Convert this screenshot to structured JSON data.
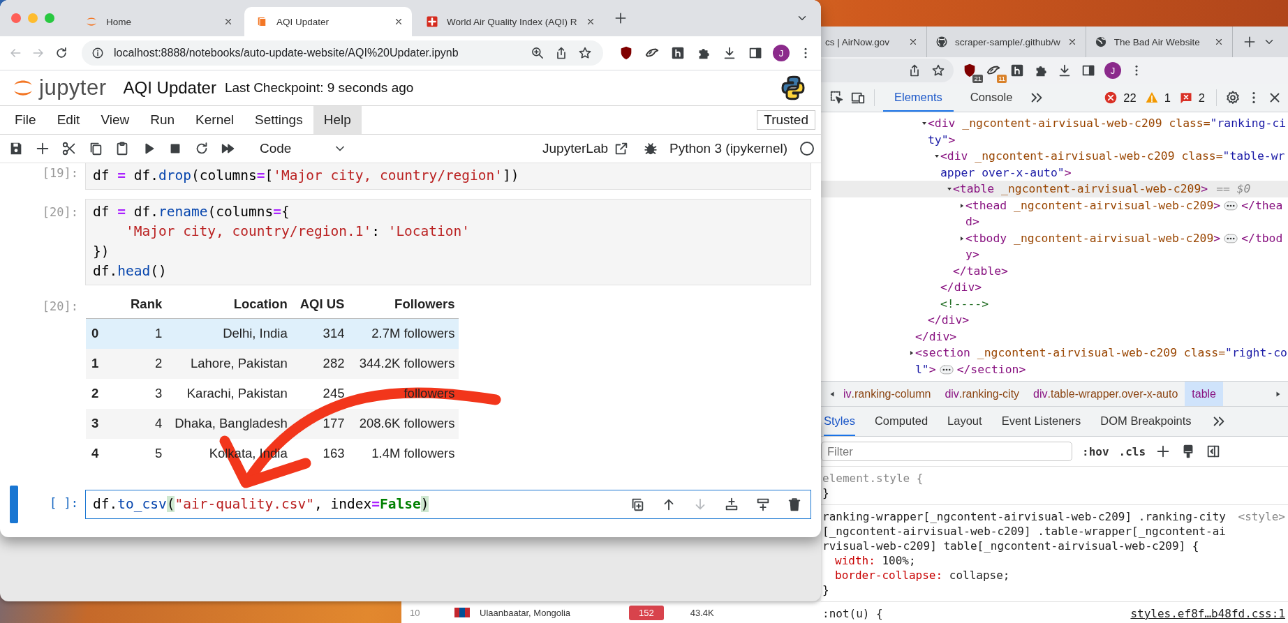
{
  "back_window": {
    "tabs": [
      {
        "title": "cs | AirNow.gov",
        "selected": false
      },
      {
        "title": "scraper-sample/.github/w",
        "selected": false
      },
      {
        "title": "The Bad Air Website",
        "selected": false
      }
    ],
    "extension_badges": [
      "21",
      "11"
    ],
    "avatar": "J",
    "page_row": {
      "rank": "10",
      "location": "Ulaanbaatar, Mongolia",
      "aqi": "152",
      "followers": "43.4K"
    },
    "devtools": {
      "panel_tabs": [
        {
          "label": "Elements",
          "selected": true
        },
        {
          "label": "Console",
          "selected": false
        }
      ],
      "counts": {
        "errors": "22",
        "warnings": "1",
        "issues": "2"
      },
      "dom": [
        {
          "close": "</div>",
          "children": [
            {
              "kind": "element",
              "open": "<div _ngcontent-airvisual-web-c209 class=\"ranking-city\">",
              "selected": false,
              "expanded": true,
              "close": "</div>",
              "children": [
                {
                  "kind": "element",
                  "open": "<div _ngcontent-airvisual-web-c209 class=\"table-wrapper over-x-auto\">",
                  "selected": false,
                  "expanded": true,
                  "close": "</div>",
                  "children": [
                    {
                      "kind": "element",
                      "open": "<table _ngcontent-airvisual-web-c209>",
                      "selected": true,
                      "console_ref": "== $0",
                      "expanded": true,
                      "close": "</table>",
                      "children": [
                        {
                          "kind": "element",
                          "open": "<thead _ngcontent-airvisual-web-c209>",
                          "selected": false,
                          "expanded": false,
                          "close": "</thead>"
                        },
                        {
                          "kind": "element",
                          "open": "<tbody _ngcontent-airvisual-web-c209>",
                          "selected": false,
                          "expanded": false,
                          "close": "</tbody>"
                        }
                      ]
                    }
                  ]
                },
                {
                  "kind": "comment",
                  "open": "<!---->"
                }
              ]
            }
          ]
        },
        {
          "kind": "element",
          "open": "<section _ngcontent-airvisual-web-c209 class=\"right-col\">",
          "selected": false,
          "expanded": false,
          "close": "</section>"
        }
      ],
      "breadcrumbs": [
        {
          "label": "iv.ranking-column",
          "selected": false
        },
        {
          "label": "div.ranking-city",
          "selected": false
        },
        {
          "label": "div.table-wrapper.over-x-auto",
          "selected": false
        },
        {
          "label": "table",
          "selected": true
        }
      ],
      "style_tabs": [
        {
          "label": "Styles",
          "selected": true
        },
        {
          "label": "Computed",
          "selected": false
        },
        {
          "label": "Layout",
          "selected": false
        },
        {
          "label": "Event Listeners",
          "selected": false
        },
        {
          "label": "DOM Breakpoints",
          "selected": false
        }
      ],
      "filter_placeholder": "Filter",
      "hov": ":hov",
      "cls": ".cls",
      "rules": [
        {
          "selector": "element.style {",
          "close": "}"
        },
        {
          "selector": "ranking-wrapper[_ngcontent-airvisual-web-c209] .ranking-city[_ngcontent-airvisual-web-c209] .table-wrapper[_ngcontent-airvisual-web-c209] table[_ngcontent-airvisual-web-c209] {",
          "source": "<style>",
          "props": [
            {
              "name": "width:",
              "value": "100%;"
            },
            {
              "name": "border-collapse:",
              "value": "collapse;"
            }
          ],
          "close": "}"
        },
        {
          "selector": ":not(u) {",
          "source": "styles.ef8f…b48fd.css:1"
        }
      ]
    }
  },
  "front_window": {
    "tabs": [
      {
        "title": "Home",
        "selected": false
      },
      {
        "title": "AQI Updater",
        "selected": true
      },
      {
        "title": "World Air Quality Index (AQI) R",
        "selected": false
      }
    ],
    "url": "localhost:8888/notebooks/auto-update-website/AQI%20Updater.ipynb",
    "avatar": "J",
    "jupyter": {
      "logo_text": "jupyter",
      "title": "AQI Updater",
      "checkpoint": "Last Checkpoint: 9 seconds ago",
      "menu": [
        {
          "label": "File",
          "selected": false
        },
        {
          "label": "Edit",
          "selected": false
        },
        {
          "label": "View",
          "selected": false
        },
        {
          "label": "Run",
          "selected": false
        },
        {
          "label": "Kernel",
          "selected": false
        },
        {
          "label": "Settings",
          "selected": false
        },
        {
          "label": "Help",
          "selected": true
        }
      ],
      "trusted": "Trusted",
      "cell_type": "Code",
      "jupyterlab": "JupyterLab",
      "kernel": "Python 3 (ipykernel)",
      "kernel_busy": false,
      "cells": [
        {
          "kind": "code",
          "prompt": "[19]:",
          "active": false,
          "lines": [
            {
              "tokens": [
                {
                  "text": "df ",
                  "kind": "plain"
                },
                {
                  "text": "=",
                  "kind": "operator"
                },
                {
                  "text": " df.",
                  "kind": "plain"
                },
                {
                  "text": "drop",
                  "kind": "function"
                },
                {
                  "text": "(columns",
                  "kind": "plain"
                },
                {
                  "text": "=",
                  "kind": "operator"
                },
                {
                  "text": "[",
                  "kind": "plain"
                },
                {
                  "text": "'Major city, country/region'",
                  "kind": "string"
                },
                {
                  "text": "])",
                  "kind": "plain"
                }
              ]
            }
          ]
        },
        {
          "kind": "code",
          "prompt": "[20]:",
          "active": false,
          "lines": [
            {
              "tokens": [
                {
                  "text": "df ",
                  "kind": "plain"
                },
                {
                  "text": "=",
                  "kind": "operator"
                },
                {
                  "text": " df.",
                  "kind": "plain"
                },
                {
                  "text": "rename",
                  "kind": "function"
                },
                {
                  "text": "(columns",
                  "kind": "plain"
                },
                {
                  "text": "=",
                  "kind": "operator"
                },
                {
                  "text": "{",
                  "kind": "plain"
                }
              ]
            },
            {
              "indented": true,
              "tokens": [
                {
                  "text": "'Major city, country/region.1'",
                  "kind": "string"
                },
                {
                  "text": ": ",
                  "kind": "plain"
                },
                {
                  "text": "'Location'",
                  "kind": "string"
                }
              ]
            },
            {
              "tokens": [
                {
                  "text": "})",
                  "kind": "plain"
                }
              ]
            },
            {
              "tokens": [
                {
                  "text": "df.",
                  "kind": "plain"
                },
                {
                  "text": "head",
                  "kind": "function"
                },
                {
                  "text": "()",
                  "kind": "plain"
                }
              ]
            }
          ]
        },
        {
          "kind": "output",
          "prompt": "[20]:",
          "columns": [
            "",
            "Rank",
            "Location",
            "AQI US",
            "Followers"
          ],
          "rows": [
            {
              "cells": [
                "0",
                "1",
                "Delhi, India",
                "314",
                "2.7M followers"
              ],
              "selected": true
            },
            {
              "cells": [
                "1",
                "2",
                "Lahore, Pakistan",
                "282",
                "344.2K followers"
              ],
              "selected": false
            },
            {
              "cells": [
                "2",
                "3",
                "Karachi, Pakistan",
                "245",
                "followers"
              ],
              "selected": false
            },
            {
              "cells": [
                "3",
                "4",
                "Dhaka, Bangladesh",
                "177",
                "208.6K followers"
              ],
              "selected": false
            },
            {
              "cells": [
                "4",
                "5",
                "Kolkata, India",
                "163",
                "1.4M followers"
              ],
              "selected": false
            }
          ]
        },
        {
          "kind": "code",
          "prompt": "[ ]:",
          "active": true,
          "lines": [
            {
              "tokens": [
                {
                  "text": "df.",
                  "kind": "plain"
                },
                {
                  "text": "to_csv",
                  "kind": "function"
                },
                {
                  "text": "(",
                  "kind": "bracket"
                },
                {
                  "text": "\"air-quality.csv\"",
                  "kind": "string"
                },
                {
                  "text": ", index",
                  "kind": "plain"
                },
                {
                  "text": "=",
                  "kind": "operator"
                },
                {
                  "text": "False",
                  "kind": "bool"
                },
                {
                  "text": ")",
                  "kind": "bracket"
                }
              ]
            }
          ]
        }
      ]
    }
  }
}
